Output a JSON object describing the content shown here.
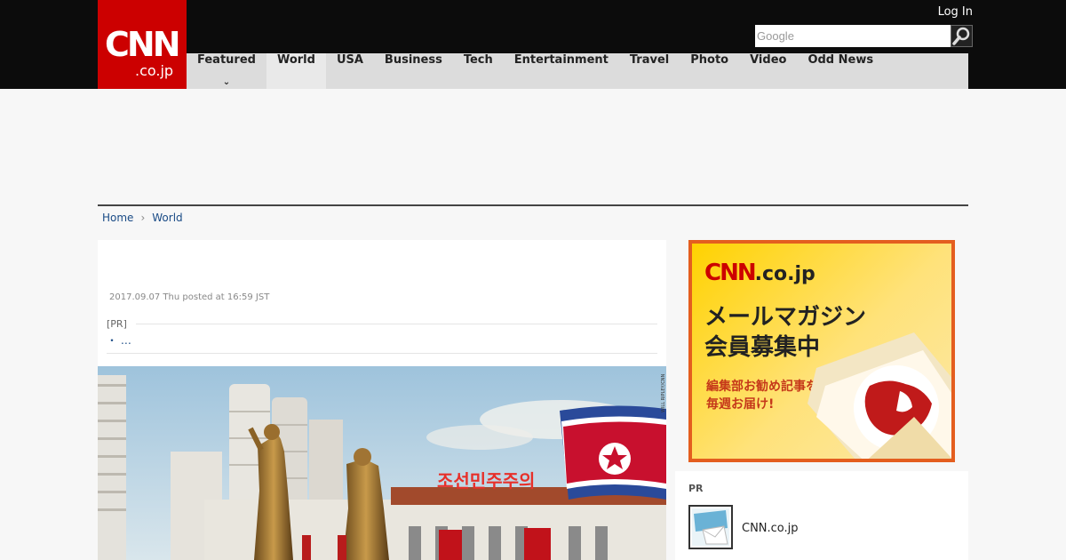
{
  "header": {
    "logo_main": "CNN",
    "logo_sub": ".co.jp",
    "login": "Log In",
    "search_placeholder": "Google"
  },
  "nav": {
    "items": [
      "Featured",
      "World",
      "USA",
      "Business",
      "Tech",
      "Entertainment",
      "Travel",
      "Photo",
      "Video",
      "Odd News"
    ],
    "active": "World"
  },
  "breadcrumb": {
    "home": "Home",
    "current": "World"
  },
  "article": {
    "date": "2017.09.07 Thu posted at 16:59 JST",
    "pr_label": "[PR]",
    "pr_item": "・ …",
    "photo_sign": "조선민주주의",
    "photo_credit": "WILL RIPLEY/CNN"
  },
  "sidebar": {
    "banner": {
      "logo": "CNN",
      "logo_sub": ".co.jp",
      "line1": "メールマガジン",
      "line2": "会員募集中",
      "sub1": "編集部お勧め記事を",
      "sub2": "毎週お届け!"
    },
    "pr_label": "PR",
    "pr_title": "CNN.co.jp"
  },
  "colors": {
    "brand_red": "#cc0000",
    "header_bg": "#0c0c0c",
    "nav_bg": "#dcdcdc",
    "link": "#1a4b86"
  }
}
